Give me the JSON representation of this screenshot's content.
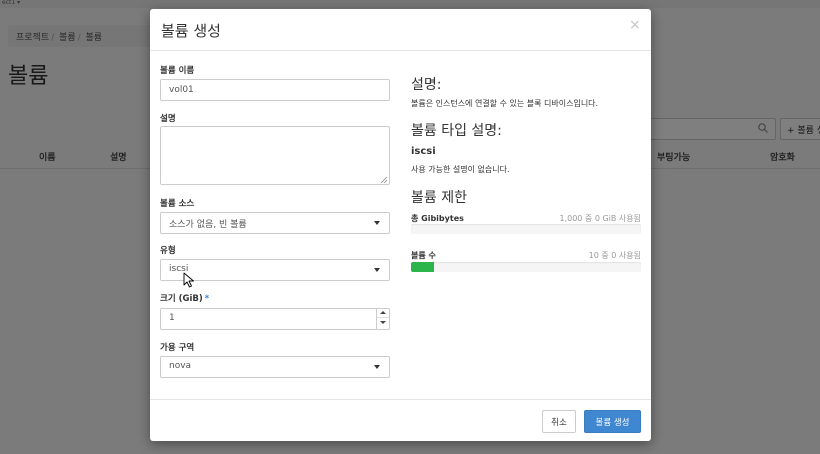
{
  "background": {
    "topbar_text": "ect1 ▾",
    "breadcrumb": [
      "프로젝트",
      "볼륨",
      "볼륨"
    ],
    "page_title": "볼륨",
    "create_button_label": "+ 볼륨 생",
    "table_headers": [
      "이름",
      "설명",
      "부팅가능",
      "암호화"
    ]
  },
  "modal": {
    "title": "볼륨 생성",
    "close_glyph": "×",
    "fields": {
      "name_label": "볼륨 이름",
      "name_value": "vol01",
      "description_label": "설명",
      "source_label": "볼륨 소스",
      "source_value": "소스가 없음, 빈 볼륨",
      "type_label": "유형",
      "type_value": "iscsi",
      "size_label": "크기 (GiB)",
      "size_required": "*",
      "size_value": "1",
      "az_label": "가용 구역",
      "az_value": "nova"
    },
    "info": {
      "desc_heading": "설명:",
      "desc_text": "볼륨은 인스턴스에 연결할 수 있는 블록 디바이스입니다.",
      "type_heading": "볼륨 타입 설명:",
      "type_name": "iscsi",
      "type_text": "사용 가능한 설명이 없습니다.",
      "limits_heading": "볼륨 제한",
      "quotas": [
        {
          "label": "총 Gibibytes",
          "usage": "1,000 중 0 GiB 사용됨",
          "fraction": 0.0
        },
        {
          "label": "볼륨 수",
          "usage": "10 중 0 사용됨",
          "fraction": 0.1
        }
      ]
    },
    "buttons": {
      "cancel": "취소",
      "submit": "볼륨 생성"
    }
  },
  "colors": {
    "primary": "#3f88d1",
    "quota_fill": "#2bb54b",
    "required_star": "#3a7fd5"
  }
}
